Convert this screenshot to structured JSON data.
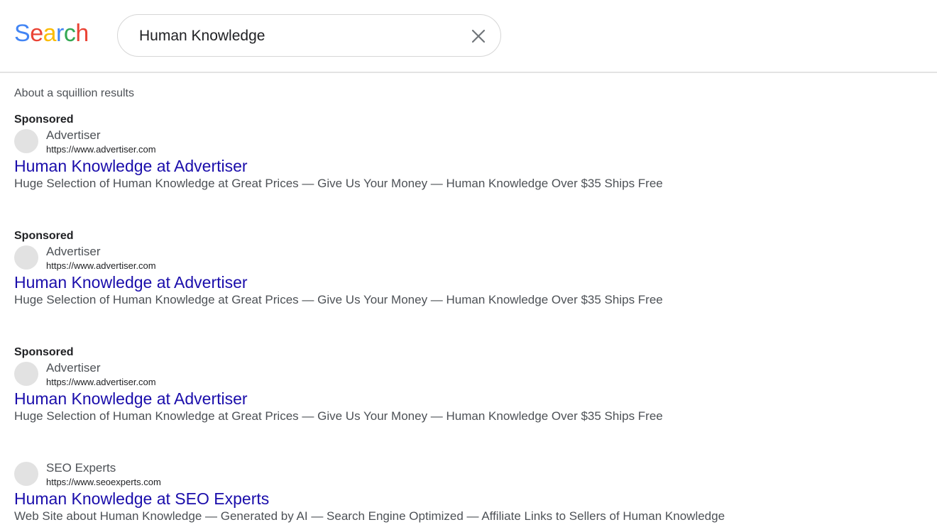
{
  "header": {
    "logo": [
      "S",
      "e",
      "a",
      "r",
      "c",
      "h"
    ],
    "logo_colors": [
      "#4285f4",
      "#ea4335",
      "#fbbc05",
      "#4285f4",
      "#34a853",
      "#ea4335"
    ],
    "search": {
      "value": "Human Knowledge",
      "clear_icon": "close-icon"
    }
  },
  "results": {
    "count_text": "About a squillion results",
    "items": [
      {
        "sponsored_label": "Sponsored",
        "site_name": "Advertiser",
        "site_url": "https://www.advertiser.com",
        "title": "Human Knowledge at Advertiser",
        "description": "Huge Selection of Human Knowledge at Great Prices — Give Us Your Money — Human Knowledge Over $35 Ships Free"
      },
      {
        "sponsored_label": "Sponsored",
        "site_name": "Advertiser",
        "site_url": "https://www.advertiser.com",
        "title": "Human Knowledge at Advertiser",
        "description": "Huge Selection of Human Knowledge at Great Prices — Give Us Your Money — Human Knowledge Over $35 Ships Free"
      },
      {
        "sponsored_label": "Sponsored",
        "site_name": "Advertiser",
        "site_url": "https://www.advertiser.com",
        "title": "Human Knowledge at Advertiser",
        "description": "Huge Selection of Human Knowledge at Great Prices — Give Us Your Money — Human Knowledge Over $35 Ships Free"
      },
      {
        "site_name": "SEO Experts",
        "site_url": "https://www.seoexperts.com",
        "title": "Human Knowledge at SEO Experts",
        "description": "Web Site about Human Knowledge — Generated by AI — Search Engine Optimized — Affiliate Links to Sellers of Human Knowledge"
      }
    ]
  },
  "colors": {
    "link": "#1a0dab",
    "favicon": "#e2e2e2",
    "divider": "#e3e3e3"
  }
}
